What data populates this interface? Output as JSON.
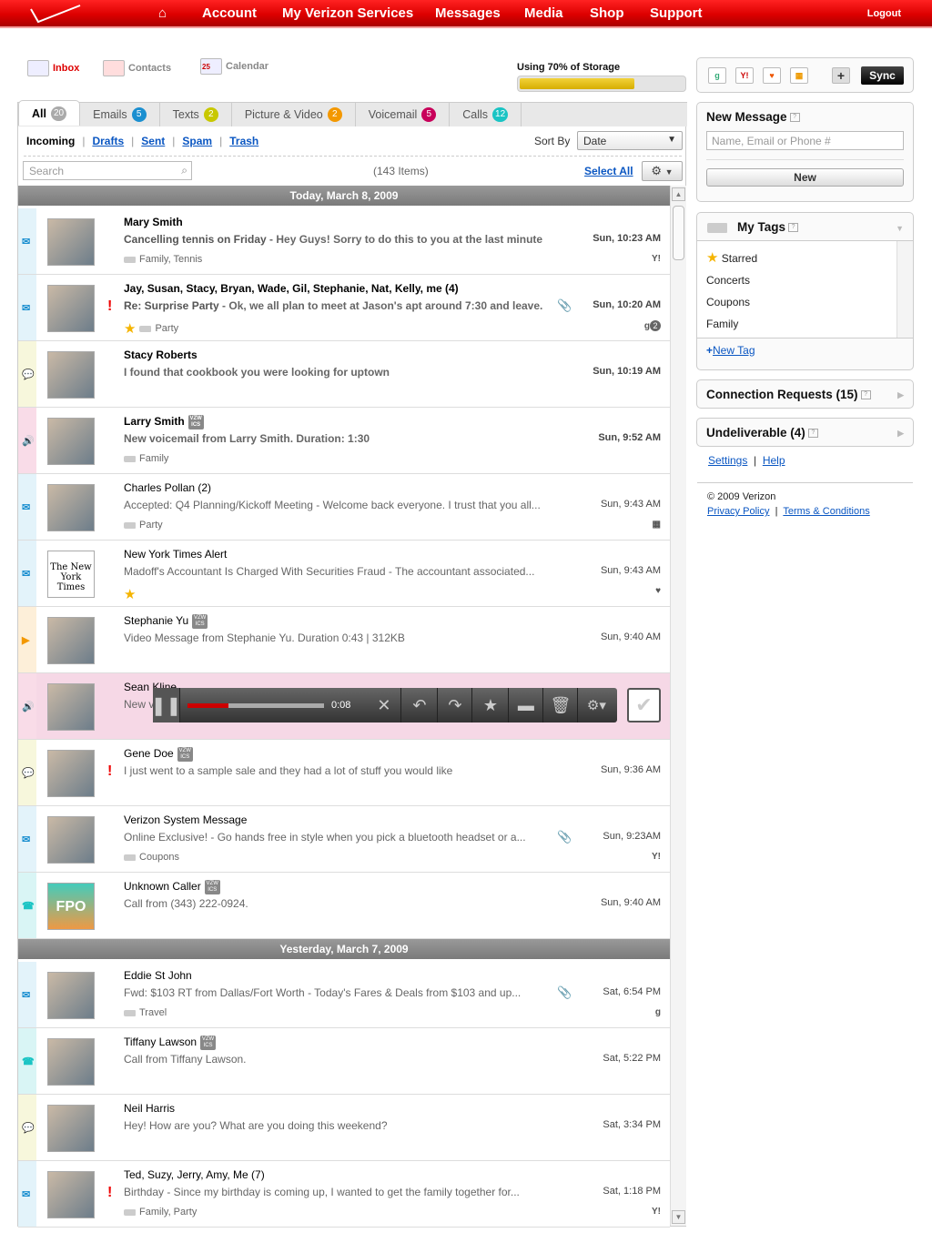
{
  "topnav": {
    "items": [
      "Account",
      "My Verizon Services",
      "Messages",
      "Media",
      "Shop",
      "Support"
    ],
    "logout": "Logout"
  },
  "apps": {
    "inbox": "Inbox",
    "contacts": "Contacts",
    "calendar": "Calendar",
    "calendar_day": "25"
  },
  "storage": {
    "label": "Using 70% of Storage",
    "percent": 70
  },
  "tabs": [
    {
      "label": "All",
      "count": "20",
      "color": "#aaaaaa"
    },
    {
      "label": "Emails",
      "count": "5",
      "color": "#1b8fd0"
    },
    {
      "label": "Texts",
      "count": "2",
      "color": "#c8c800"
    },
    {
      "label": "Picture & Video",
      "count": "2",
      "color": "#f39800"
    },
    {
      "label": "Voicemail",
      "count": "5",
      "color": "#c8005a"
    },
    {
      "label": "Calls",
      "count": "12",
      "color": "#1ac4c4"
    }
  ],
  "folders": {
    "incoming": "Incoming",
    "drafts": "Drafts",
    "sent": "Sent",
    "spam": "Spam",
    "trash": "Trash"
  },
  "sort": {
    "label": "Sort By",
    "value": "Date"
  },
  "search": {
    "placeholder": "Search"
  },
  "item_count": "(143 Items)",
  "select_all": "Select All",
  "type_colors": {
    "email": "#e3f3fa",
    "text": "#f7f7dc",
    "voicemail": "#f9dce8",
    "video": "#fdefd9",
    "call": "#d9f5f5"
  },
  "groups": [
    {
      "header": "Today, March 8, 2009",
      "items": [
        {
          "type": "email",
          "name": "Mary Smith",
          "subject": "Cancelling tennis on Friday",
          "preview": "Hey Guys! Sorry to do this to you at the last minute...",
          "time": "Sun, 10:23 AM",
          "tags": "Family, Tennis",
          "unread": true,
          "source": "yahoo"
        },
        {
          "type": "email",
          "name": "Jay, Susan, Stacy, Bryan, Wade, Gil, Stephanie, Nat, Kelly, me (4)",
          "subject": "Re: Surprise Party",
          "preview": "Ok, we all plan to meet at Jason's apt around 7:30 and leave...",
          "time": "Sun, 10:20 AM",
          "tags": "Party",
          "unread": true,
          "starred": true,
          "urgent": true,
          "attachment": true,
          "source": "google",
          "source_count": "2"
        },
        {
          "type": "text",
          "name": "Stacy Roberts",
          "subject": "",
          "preview": "I found that cookbook you were looking for uptown",
          "time": "Sun, 10:19 AM",
          "unread": true
        },
        {
          "type": "voicemail",
          "name": "Larry Smith",
          "subject": "",
          "preview": "New voicemail from Larry Smith. Duration: 1:30",
          "time": "Sun, 9:52 AM",
          "tags": "Family",
          "unread": true,
          "vzw": true
        },
        {
          "type": "email",
          "name": "Charles Pollan (2)",
          "subject": "",
          "preview": "Accepted: Q4 Planning/Kickoff Meeting - Welcome back everyone. I trust that you all...",
          "time": "Sun, 9:43 AM",
          "tags": "Party",
          "source": "windows"
        },
        {
          "type": "email",
          "name": "New York Times Alert",
          "subject": "",
          "preview": "Madoff's Accountant Is Charged With Securities Fraud - The accountant associated...",
          "time": "Sun, 9:43 AM",
          "starred": true,
          "source": "aol",
          "avatar": "The New York Times"
        },
        {
          "type": "video",
          "name": "Stephanie Yu",
          "subject": "",
          "preview": "Video Message from Stephanie Yu. Duration 0:43 | 312KB",
          "time": "Sun, 9:40 AM",
          "vzw": true
        },
        {
          "type": "voicemail",
          "name": "Sean Kline",
          "subject": "",
          "preview": "New voicemail from Sean Kline. Duration: 0:4",
          "time": "",
          "selected": true
        },
        {
          "type": "text",
          "name": "Gene Doe",
          "subject": "",
          "preview": "I just went to a sample sale and they had a lot of stuff you would like",
          "time": "Sun, 9:36 AM",
          "urgent": true,
          "vzw": true
        },
        {
          "type": "email",
          "name": "Verizon System Message",
          "subject": "",
          "preview": "Online Exclusive! - Go hands free in style when you pick a bluetooth headset or a...",
          "time": "Sun, 9:23AM",
          "tags": "Coupons",
          "attachment": true,
          "source": "yahoo"
        },
        {
          "type": "call",
          "name": "Unknown Caller",
          "subject": "",
          "preview": "Call from (343) 222-0924.",
          "time": "Sun, 9:40 AM",
          "vzw": true,
          "avatar": "FPO"
        }
      ]
    },
    {
      "header": "Yesterday, March 7, 2009",
      "items": [
        {
          "type": "email",
          "name": "Eddie St John",
          "subject": "",
          "preview": "Fwd: $103 RT from Dallas/Fort Worth - Today's Fares & Deals from $103 and up...",
          "time": "Sat, 6:54 PM",
          "tags": "Travel",
          "attachment": true,
          "source": "google"
        },
        {
          "type": "call",
          "name": "Tiffany Lawson",
          "subject": "",
          "preview": "Call from Tiffany Lawson.",
          "time": "Sat, 5:22 PM",
          "vzw": true
        },
        {
          "type": "text",
          "name": "Neil Harris",
          "subject": "",
          "preview": "Hey! How are you? What are you doing this weekend?",
          "time": "Sat, 3:34 PM"
        },
        {
          "type": "email",
          "name": "Ted, Suzy, Jerry, Amy, Me (7)",
          "subject": "",
          "preview": "Birthday - Since my birthday is coming up, I wanted to get the family together for...",
          "time": "Sat, 1:18 PM",
          "tags": "Family, Party",
          "urgent": true,
          "source": "yahoo"
        }
      ]
    }
  ],
  "player": {
    "elapsed": "0:08",
    "progress_percent": 30
  },
  "sync": {
    "label": "Sync"
  },
  "new_message": {
    "title": "New Message",
    "placeholder": "Name, Email or Phone #",
    "button": "New"
  },
  "my_tags": {
    "title": "My Tags",
    "items": [
      "Starred",
      "Concerts",
      "Coupons",
      "Family"
    ],
    "new_tag": "New Tag"
  },
  "connection_requests": "Connection Requests (15)",
  "undeliverable": "Undeliverable (4)",
  "links": {
    "settings": "Settings",
    "help": "Help"
  },
  "footer": {
    "copyright": "© 2009 Verizon",
    "privacy": "Privacy Policy",
    "terms": "Terms & Conditions"
  }
}
